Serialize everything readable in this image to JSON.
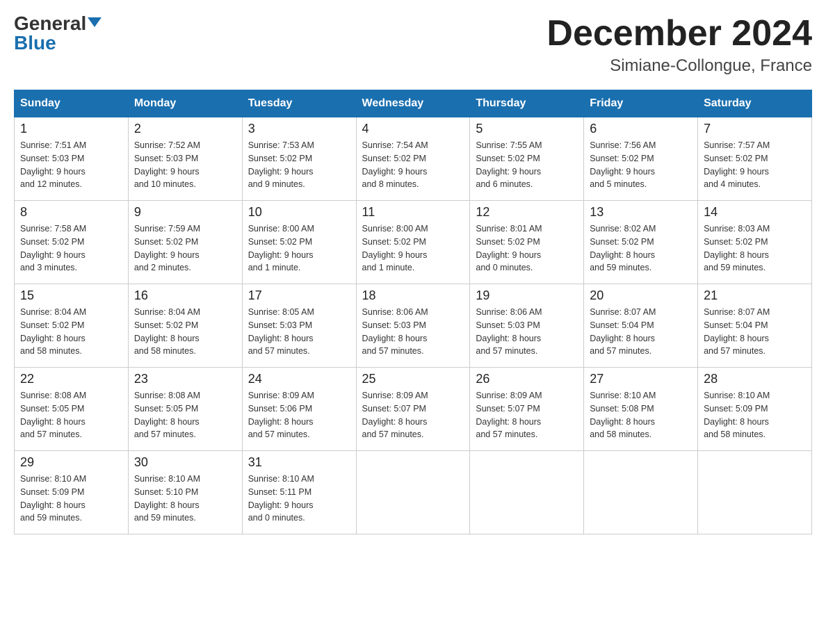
{
  "header": {
    "logo_general": "General",
    "logo_blue": "Blue",
    "month_title": "December 2024",
    "location": "Simiane-Collongue, France"
  },
  "days_of_week": [
    "Sunday",
    "Monday",
    "Tuesday",
    "Wednesday",
    "Thursday",
    "Friday",
    "Saturday"
  ],
  "weeks": [
    [
      {
        "day": "1",
        "sunrise": "7:51 AM",
        "sunset": "5:03 PM",
        "daylight": "9 hours and 12 minutes."
      },
      {
        "day": "2",
        "sunrise": "7:52 AM",
        "sunset": "5:03 PM",
        "daylight": "9 hours and 10 minutes."
      },
      {
        "day": "3",
        "sunrise": "7:53 AM",
        "sunset": "5:02 PM",
        "daylight": "9 hours and 9 minutes."
      },
      {
        "day": "4",
        "sunrise": "7:54 AM",
        "sunset": "5:02 PM",
        "daylight": "9 hours and 8 minutes."
      },
      {
        "day": "5",
        "sunrise": "7:55 AM",
        "sunset": "5:02 PM",
        "daylight": "9 hours and 6 minutes."
      },
      {
        "day": "6",
        "sunrise": "7:56 AM",
        "sunset": "5:02 PM",
        "daylight": "9 hours and 5 minutes."
      },
      {
        "day": "7",
        "sunrise": "7:57 AM",
        "sunset": "5:02 PM",
        "daylight": "9 hours and 4 minutes."
      }
    ],
    [
      {
        "day": "8",
        "sunrise": "7:58 AM",
        "sunset": "5:02 PM",
        "daylight": "9 hours and 3 minutes."
      },
      {
        "day": "9",
        "sunrise": "7:59 AM",
        "sunset": "5:02 PM",
        "daylight": "9 hours and 2 minutes."
      },
      {
        "day": "10",
        "sunrise": "8:00 AM",
        "sunset": "5:02 PM",
        "daylight": "9 hours and 1 minute."
      },
      {
        "day": "11",
        "sunrise": "8:00 AM",
        "sunset": "5:02 PM",
        "daylight": "9 hours and 1 minute."
      },
      {
        "day": "12",
        "sunrise": "8:01 AM",
        "sunset": "5:02 PM",
        "daylight": "9 hours and 0 minutes."
      },
      {
        "day": "13",
        "sunrise": "8:02 AM",
        "sunset": "5:02 PM",
        "daylight": "8 hours and 59 minutes."
      },
      {
        "day": "14",
        "sunrise": "8:03 AM",
        "sunset": "5:02 PM",
        "daylight": "8 hours and 59 minutes."
      }
    ],
    [
      {
        "day": "15",
        "sunrise": "8:04 AM",
        "sunset": "5:02 PM",
        "daylight": "8 hours and 58 minutes."
      },
      {
        "day": "16",
        "sunrise": "8:04 AM",
        "sunset": "5:02 PM",
        "daylight": "8 hours and 58 minutes."
      },
      {
        "day": "17",
        "sunrise": "8:05 AM",
        "sunset": "5:03 PM",
        "daylight": "8 hours and 57 minutes."
      },
      {
        "day": "18",
        "sunrise": "8:06 AM",
        "sunset": "5:03 PM",
        "daylight": "8 hours and 57 minutes."
      },
      {
        "day": "19",
        "sunrise": "8:06 AM",
        "sunset": "5:03 PM",
        "daylight": "8 hours and 57 minutes."
      },
      {
        "day": "20",
        "sunrise": "8:07 AM",
        "sunset": "5:04 PM",
        "daylight": "8 hours and 57 minutes."
      },
      {
        "day": "21",
        "sunrise": "8:07 AM",
        "sunset": "5:04 PM",
        "daylight": "8 hours and 57 minutes."
      }
    ],
    [
      {
        "day": "22",
        "sunrise": "8:08 AM",
        "sunset": "5:05 PM",
        "daylight": "8 hours and 57 minutes."
      },
      {
        "day": "23",
        "sunrise": "8:08 AM",
        "sunset": "5:05 PM",
        "daylight": "8 hours and 57 minutes."
      },
      {
        "day": "24",
        "sunrise": "8:09 AM",
        "sunset": "5:06 PM",
        "daylight": "8 hours and 57 minutes."
      },
      {
        "day": "25",
        "sunrise": "8:09 AM",
        "sunset": "5:07 PM",
        "daylight": "8 hours and 57 minutes."
      },
      {
        "day": "26",
        "sunrise": "8:09 AM",
        "sunset": "5:07 PM",
        "daylight": "8 hours and 57 minutes."
      },
      {
        "day": "27",
        "sunrise": "8:10 AM",
        "sunset": "5:08 PM",
        "daylight": "8 hours and 58 minutes."
      },
      {
        "day": "28",
        "sunrise": "8:10 AM",
        "sunset": "5:09 PM",
        "daylight": "8 hours and 58 minutes."
      }
    ],
    [
      {
        "day": "29",
        "sunrise": "8:10 AM",
        "sunset": "5:09 PM",
        "daylight": "8 hours and 59 minutes."
      },
      {
        "day": "30",
        "sunrise": "8:10 AM",
        "sunset": "5:10 PM",
        "daylight": "8 hours and 59 minutes."
      },
      {
        "day": "31",
        "sunrise": "8:10 AM",
        "sunset": "5:11 PM",
        "daylight": "9 hours and 0 minutes."
      },
      null,
      null,
      null,
      null
    ]
  ],
  "labels": {
    "sunrise": "Sunrise:",
    "sunset": "Sunset:",
    "daylight": "Daylight:"
  }
}
